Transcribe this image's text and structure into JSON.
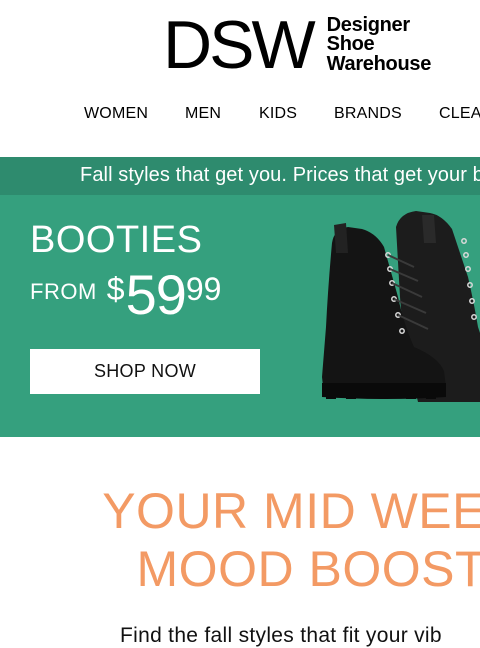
{
  "brand": {
    "logo_mark": "DSW",
    "logo_tagline": [
      "Designer",
      "Shoe",
      "Warehouse"
    ]
  },
  "nav": {
    "items": [
      "WOMEN",
      "MEN",
      "KIDS",
      "BRANDS",
      "CLEA"
    ]
  },
  "promo_strip": {
    "text": "Fall styles that get you. Prices that get your b"
  },
  "hero": {
    "title": "BOOTIES",
    "price_prefix": "FROM",
    "price_currency": "$",
    "price_main": "59",
    "price_cents": "99",
    "cta_label": "SHOP NOW",
    "image_icon": "black-lace-up-boots-image"
  },
  "headline": {
    "line1": "YOUR MID WEE",
    "line2": "MOOD BOOST"
  },
  "subtext": "Find the fall styles that fit your vib",
  "colors": {
    "promo_strip_bg": "#2e8b6e",
    "hero_bg": "#35a07e",
    "headline_color": "#f39a64",
    "cta_bg": "#ffffff"
  }
}
